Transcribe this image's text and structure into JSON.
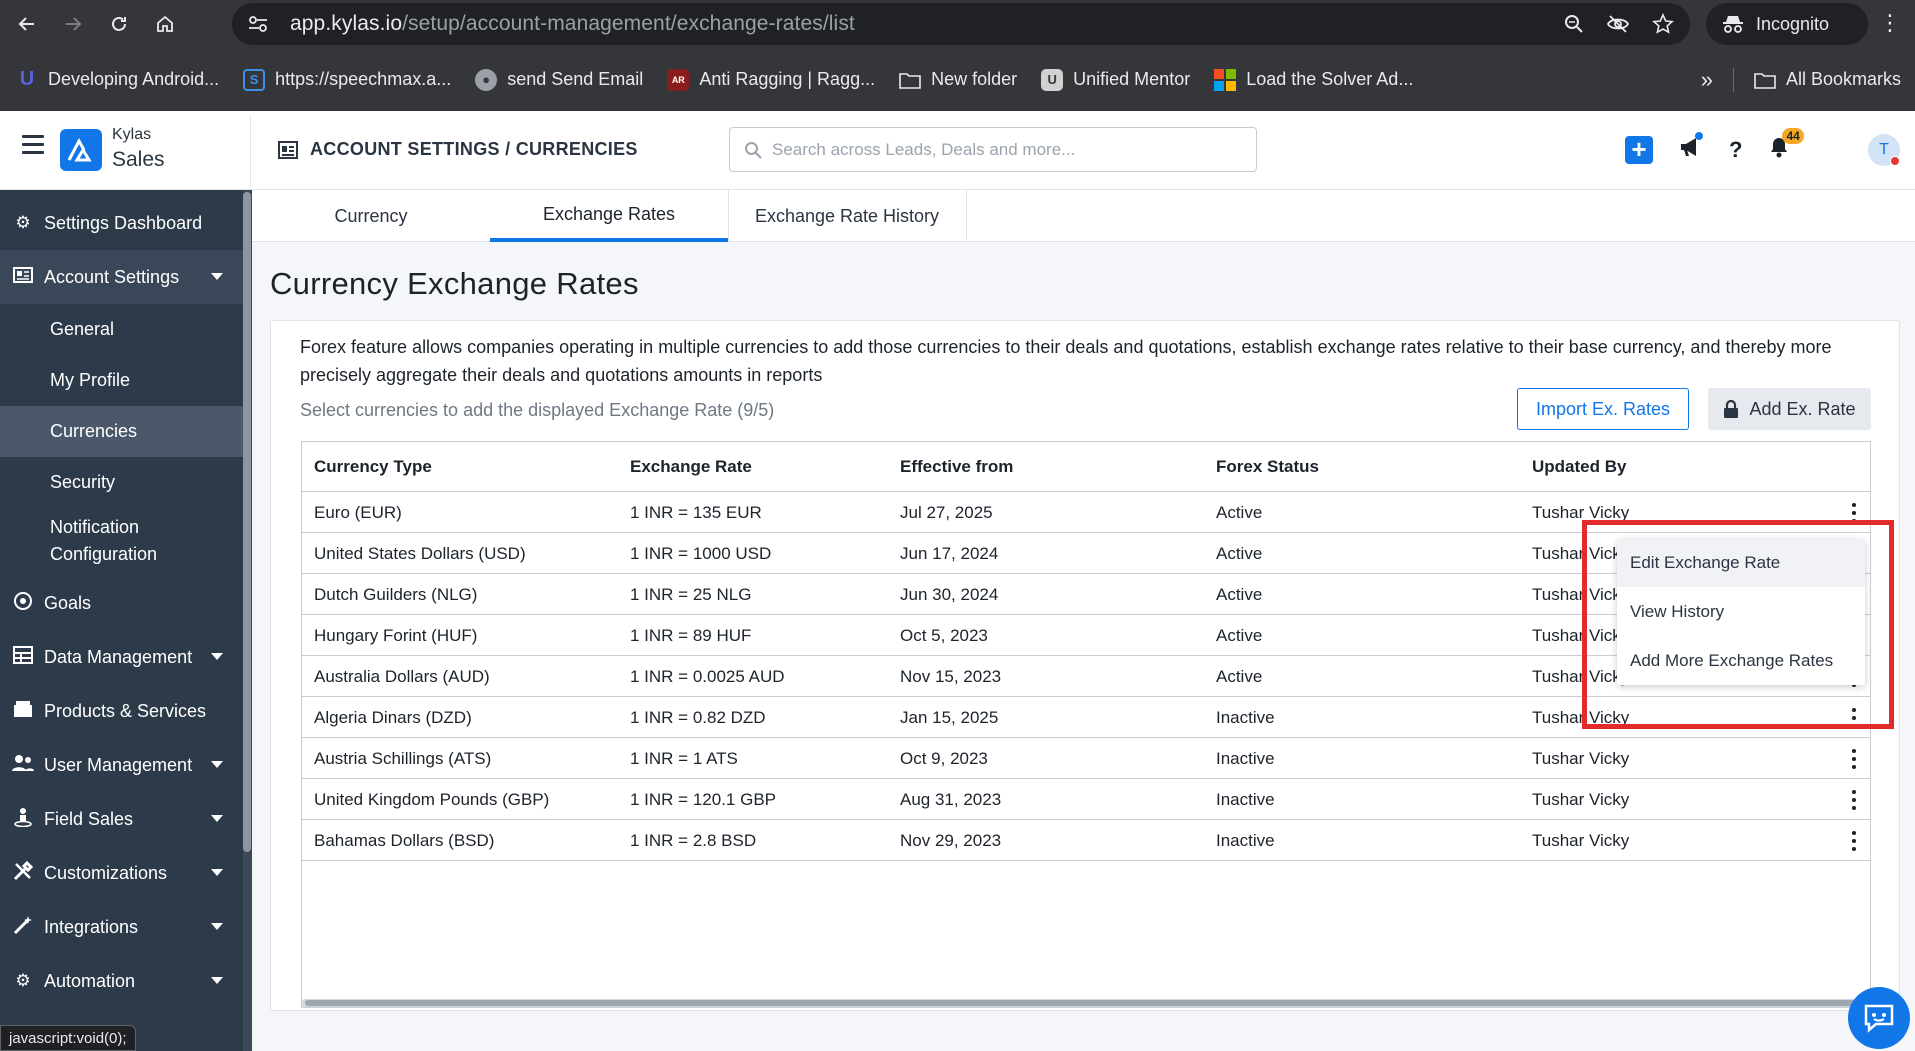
{
  "browser": {
    "url_host": "app.kylas.io",
    "url_path": "/setup/account-management/exchange-rates/list",
    "incognito_label": "Incognito",
    "bookmarks": [
      {
        "label": "Developing Android...",
        "icon": "android-dev-icon",
        "color": "#5b5fe0"
      },
      {
        "label": "https://speechmax.a...",
        "icon": "speechmax-icon",
        "color": "#3f8fe8"
      },
      {
        "label": "send Send Email",
        "icon": "globe-icon",
        "color": "#9aa0a6"
      },
      {
        "label": "Anti Ragging | Ragg...",
        "icon": "anti-ragging-icon",
        "color": "#8a1c1c"
      },
      {
        "label": "New folder",
        "icon": "folder-icon",
        "color": "#e8eaed"
      },
      {
        "label": "Unified Mentor",
        "icon": "unified-mentor-icon",
        "color": "#d0d0d0"
      },
      {
        "label": "Load the Solver Ad...",
        "icon": "microsoft-icon",
        "color": "#f25022"
      }
    ],
    "all_bookmarks_label": "All Bookmarks",
    "status_text": "javascript:void(0);"
  },
  "header": {
    "brand_top": "Kylas",
    "brand_bottom": "Sales",
    "breadcrumb": "ACCOUNT SETTINGS / CURRENCIES",
    "search_placeholder": "Search across Leads, Deals and more...",
    "notification_count": "44",
    "avatar_initial": "T"
  },
  "sidebar": {
    "items": [
      {
        "label": "Settings Dashboard",
        "icon": "gear-icon"
      },
      {
        "label": "Account Settings",
        "icon": "account-settings-icon"
      },
      {
        "label": "Goals",
        "icon": "target-icon"
      },
      {
        "label": "Data Management",
        "icon": "table-icon"
      },
      {
        "label": "Products & Services",
        "icon": "box-icon"
      },
      {
        "label": "User Management",
        "icon": "users-icon"
      },
      {
        "label": "Field Sales",
        "icon": "person-location-icon"
      },
      {
        "label": "Customizations",
        "icon": "tools-icon"
      },
      {
        "label": "Integrations",
        "icon": "magic-wand-icon"
      },
      {
        "label": "Automation",
        "icon": "cogs-icon"
      }
    ],
    "sub_items": [
      {
        "label": "General"
      },
      {
        "label": "My Profile"
      },
      {
        "label": "Currencies"
      },
      {
        "label": "Security"
      },
      {
        "label": "Notification Configuration"
      }
    ]
  },
  "tabs": [
    {
      "label": "Currency"
    },
    {
      "label": "Exchange Rates"
    },
    {
      "label": "Exchange Rate History"
    }
  ],
  "page": {
    "title": "Currency Exchange Rates",
    "description": "Forex feature allows companies operating in multiple currencies to add those currencies to their deals and quotations, establish exchange rates relative to their base currency, and thereby more precisely aggregate their deals and quotations amounts in reports",
    "select_hint": "Select currencies to add the displayed Exchange Rate (9/5)",
    "import_label": "Import Ex. Rates",
    "add_label": "Add Ex. Rate"
  },
  "table": {
    "columns": [
      "Currency Type",
      "Exchange Rate",
      "Effective from",
      "Forex Status",
      "Updated By"
    ],
    "rows": [
      [
        "Euro (EUR)",
        "1 INR = 135 EUR",
        "Jul 27, 2025",
        "Active",
        "Tushar Vicky"
      ],
      [
        "United States Dollars (USD)",
        "1 INR = 1000 USD",
        "Jun 17, 2024",
        "Active",
        "Tushar Vicky"
      ],
      [
        "Dutch Guilders (NLG)",
        "1 INR = 25 NLG",
        "Jun 30, 2024",
        "Active",
        "Tushar Vicky"
      ],
      [
        "Hungary Forint (HUF)",
        "1 INR = 89 HUF",
        "Oct 5, 2023",
        "Active",
        "Tushar Vicky"
      ],
      [
        "Australia Dollars (AUD)",
        "1 INR = 0.0025 AUD",
        "Nov 15, 2023",
        "Active",
        "Tushar Vicky"
      ],
      [
        "Algeria Dinars (DZD)",
        "1 INR = 0.82 DZD",
        "Jan 15, 2025",
        "Inactive",
        "Tushar Vicky"
      ],
      [
        "Austria Schillings (ATS)",
        "1 INR = 1 ATS",
        "Oct 9, 2023",
        "Inactive",
        "Tushar Vicky"
      ],
      [
        "United Kingdom Pounds (GBP)",
        "1 INR = 120.1 GBP",
        "Aug 31, 2023",
        "Inactive",
        "Tushar Vicky"
      ],
      [
        "Bahamas Dollars (BSD)",
        "1 INR = 2.8 BSD",
        "Nov 29, 2023",
        "Inactive",
        "Tushar Vicky"
      ]
    ]
  },
  "dropdown": {
    "items": [
      {
        "label": "Edit Exchange Rate"
      },
      {
        "label": "View History"
      },
      {
        "label": "Add More Exchange Rates"
      }
    ]
  },
  "colors": {
    "accent": "#1176e8",
    "sidebar_bg": "#2d3a4a",
    "highlight": "#e32b2b"
  }
}
